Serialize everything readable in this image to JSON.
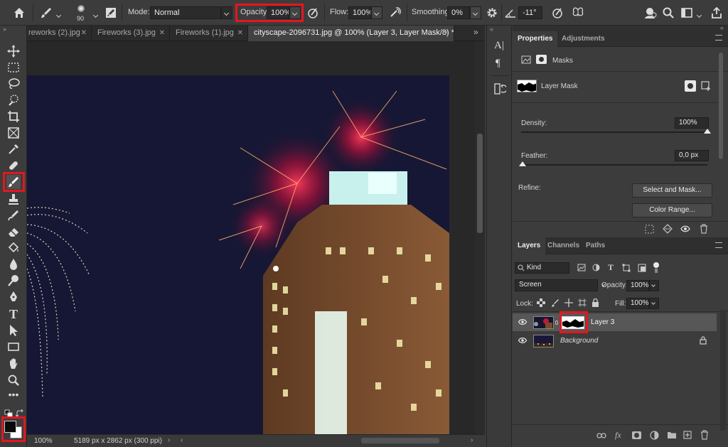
{
  "options_bar": {
    "brush_size": "90",
    "mode_label": "Mode:",
    "mode_value": "Normal",
    "opacity_label": "Opacity:",
    "opacity_value": "100%",
    "flow_label": "Flow:",
    "flow_value": "100%",
    "smoothing_label": "Smoothing:",
    "smoothing_value": "0%",
    "angle_value": "-11°"
  },
  "tabs": [
    {
      "label": "reworks (2).jpg"
    },
    {
      "label": "Fireworks (3).jpg"
    },
    {
      "label": "Fireworks (1).jpg"
    },
    {
      "label": "cityscape-2096731.jpg @ 100% (Layer 3, Layer Mask/8) *"
    }
  ],
  "status": {
    "zoom": "100%",
    "doc_info": "5189 px x 2862 px (300 ppi)"
  },
  "properties_panel": {
    "tabs": [
      "Properties",
      "Adjustments"
    ],
    "masks_label": "Masks",
    "layer_mask_label": "Layer Mask",
    "density_label": "Density:",
    "density_value": "100%",
    "density_level": 1.0,
    "feather_label": "Feather:",
    "feather_value": "0,0 px",
    "feather_level": 0.0,
    "refine_label": "Refine:",
    "select_and_mask_label": "Select and Mask...",
    "color_range_label": "Color Range..."
  },
  "layers_panel": {
    "tabs": [
      "Layers",
      "Channels",
      "Paths"
    ],
    "filter_kind": "Kind",
    "blend_mode": "Screen",
    "opacity_label": "Opacity:",
    "opacity_value": "100%",
    "lock_label": "Lock:",
    "fill_label": "Fill:",
    "fill_value": "100%",
    "layers": [
      {
        "name": "Layer 3",
        "selected": true
      },
      {
        "name": "Background",
        "locked": true
      }
    ]
  },
  "colors": {
    "highlight": "#e5161f",
    "panel_bg": "#3c3c3c",
    "selected_layer": "#575757"
  }
}
